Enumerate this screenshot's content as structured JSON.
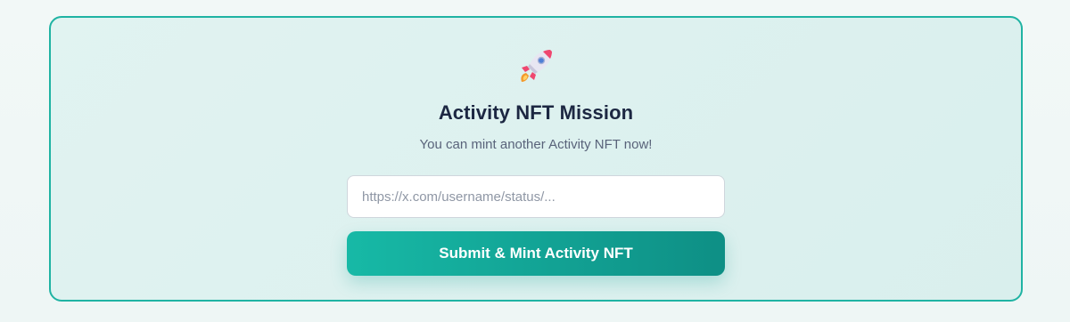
{
  "card": {
    "icon": "rocket-icon",
    "title": "Activity NFT Mission",
    "subtitle": "You can mint another Activity NFT now!",
    "input": {
      "value": "",
      "placeholder": "https://x.com/username/status/..."
    },
    "submit_label": "Submit & Mint Activity NFT"
  },
  "colors": {
    "accent": "#17b9a6",
    "accent_dark": "#0e8f85",
    "border": "#1fb3a3",
    "title": "#1c2742"
  }
}
